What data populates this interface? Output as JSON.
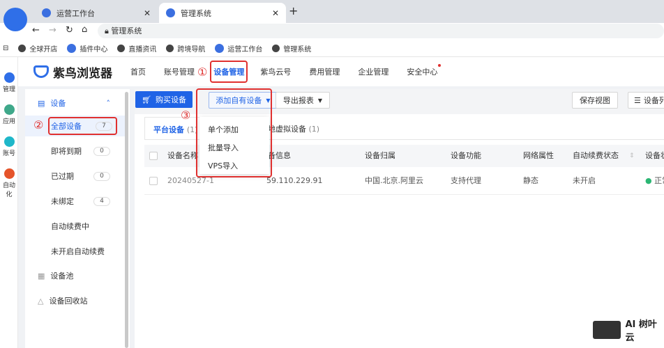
{
  "browser": {
    "tabs": [
      {
        "label": "运营工作台"
      },
      {
        "label": "管理系统"
      }
    ],
    "address": "管理系统",
    "bookmarks": [
      "全球开店",
      "插件中心",
      "直播资讯",
      "跨境导航",
      "运营工作台",
      "管理系统"
    ]
  },
  "rail": [
    "管理",
    "应用",
    "账号",
    "自动化"
  ],
  "header": {
    "logo": "紫鸟浏览器",
    "nav": [
      "首页",
      "账号管理",
      "设备管理",
      "紫鸟云号",
      "费用管理",
      "企业管理",
      "安全中心"
    ]
  },
  "sidebar": {
    "group": "设备",
    "items": [
      {
        "label": "全部设备",
        "count": "7"
      },
      {
        "label": "即将到期",
        "count": "0"
      },
      {
        "label": "已过期",
        "count": "0"
      },
      {
        "label": "未绑定",
        "count": "4"
      },
      {
        "label": "自动续费中"
      },
      {
        "label": "未开启自动续费"
      }
    ],
    "pool": "设备池",
    "recycle": "设备回收站"
  },
  "toolbar": {
    "buy": "购买设备",
    "add_own": "添加自有设备",
    "export": "导出报表",
    "save_view": "保存视图",
    "columns": "设备列"
  },
  "dropdown": [
    "单个添加",
    "批量导入",
    "VPS导入"
  ],
  "tabs": [
    {
      "label": "平台设备",
      "count": "(1)"
    },
    {
      "label": "本地虚拟设备",
      "count": "(1)"
    }
  ],
  "table": {
    "headers": [
      "设备名称",
      "设备信息",
      "设备归属",
      "设备功能",
      "网络属性",
      "自动续费状态",
      "设备状态"
    ],
    "rows": [
      [
        "20240527-1",
        "59.110.229.91",
        "中国.北京.阿里云",
        "支持代理",
        "静态",
        "未开启",
        "正常"
      ]
    ]
  },
  "annotations": [
    "①",
    "②",
    "③"
  ],
  "watermark": "AI 树叶云",
  "colors": {
    "primary": "#1f63e6",
    "annotation": "#e0302f"
  }
}
